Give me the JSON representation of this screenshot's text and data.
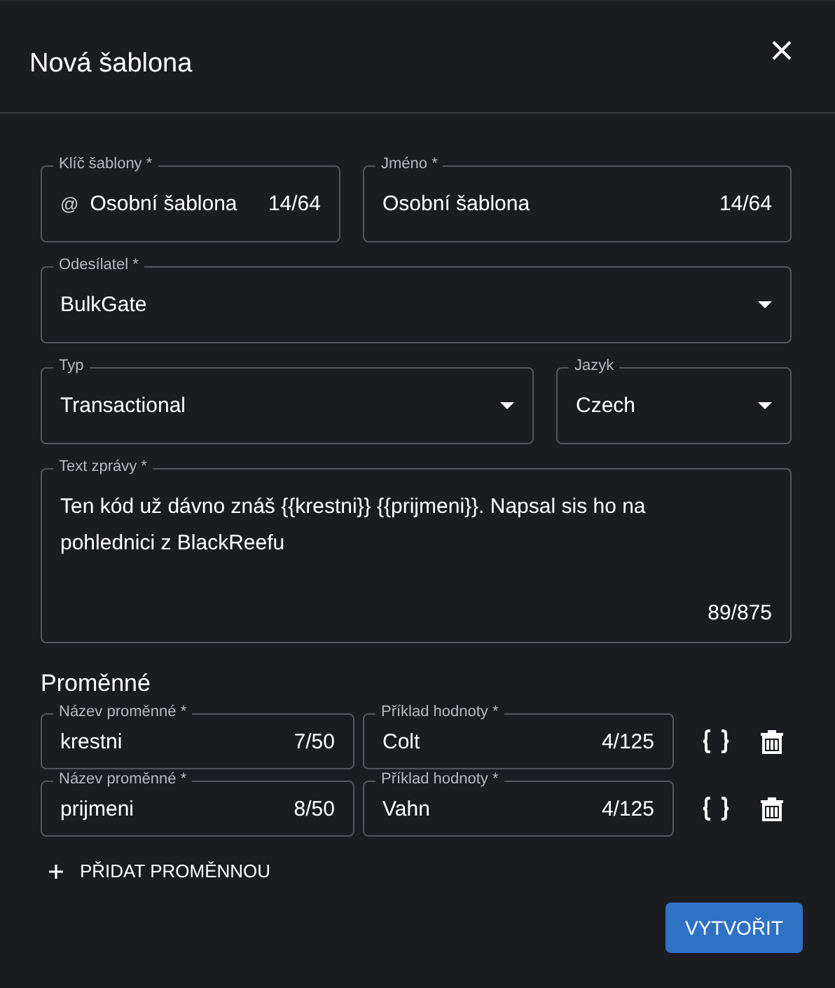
{
  "dialog": {
    "title": "Nová šablona"
  },
  "key_field": {
    "label": "Klíč šablony *",
    "prefix": "@",
    "value": "Osobní šablona",
    "counter": "14/64"
  },
  "name_field": {
    "label": "Jméno *",
    "value": "Osobní šablona",
    "counter": "14/64"
  },
  "sender_field": {
    "label": "Odesílatel *",
    "value": "BulkGate"
  },
  "type_field": {
    "label": "Typ",
    "value": "Transactional"
  },
  "language_field": {
    "label": "Jazyk",
    "value": "Czech"
  },
  "message_field": {
    "label": "Text zprávy *",
    "value": "Ten kód už dávno znáš {{krestni}} {{prijmeni}}. Napsal sis ho na pohlednici z BlackReefu",
    "counter": "89/875"
  },
  "variables": {
    "heading": "Proměnné",
    "rows": [
      {
        "name": {
          "label": "Název proměnné *",
          "value": "krestni",
          "counter": "7/50"
        },
        "example": {
          "label": "Příklad hodnoty *",
          "value": "Colt",
          "counter": "4/125"
        }
      },
      {
        "name": {
          "label": "Název proměnné *",
          "value": "prijmeni",
          "counter": "8/50"
        },
        "example": {
          "label": "Příklad hodnoty *",
          "value": "Vahn",
          "counter": "4/125"
        }
      }
    ]
  },
  "add_button": {
    "label": "PŘIDAT PROMĚNNOU"
  },
  "create_button": {
    "label": "VYTVOŘIT"
  }
}
